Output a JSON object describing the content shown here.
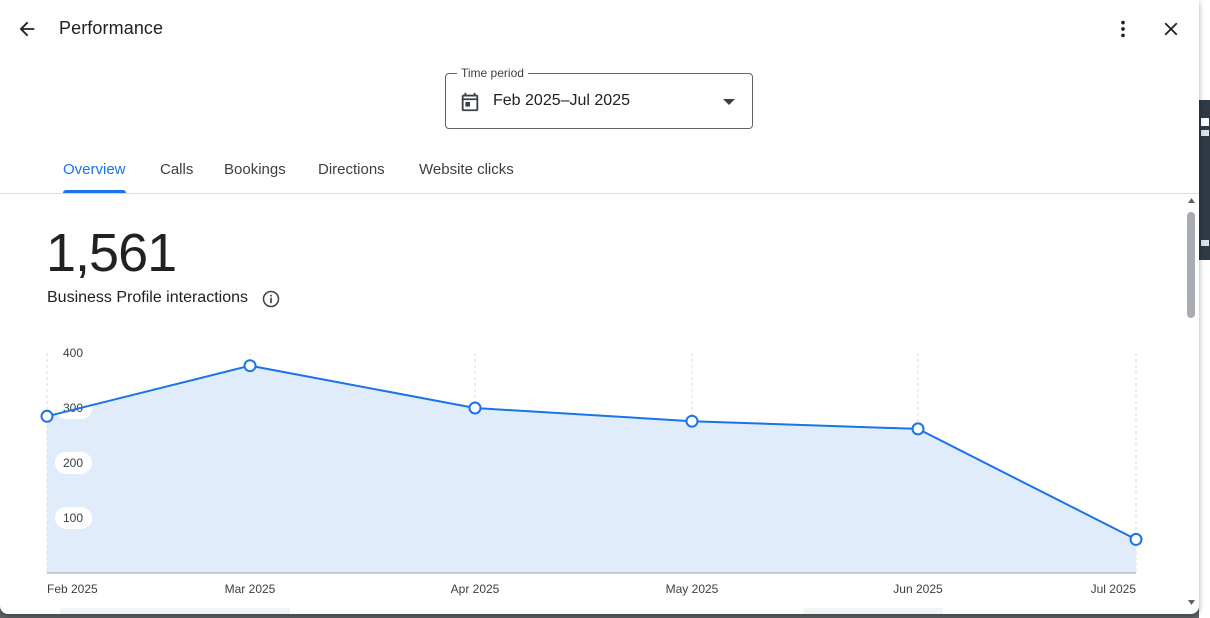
{
  "header": {
    "title": "Performance"
  },
  "time_period": {
    "label": "Time period",
    "value": "Feb 2025–Jul 2025"
  },
  "tabs": [
    {
      "label": "Overview",
      "active": true
    },
    {
      "label": "Calls",
      "active": false
    },
    {
      "label": "Bookings",
      "active": false
    },
    {
      "label": "Directions",
      "active": false
    },
    {
      "label": "Website clicks",
      "active": false
    }
  ],
  "summary": {
    "total": "1,561",
    "label": "Business Profile interactions"
  },
  "chart_data": {
    "type": "area",
    "x": [
      "Feb 2025",
      "Mar 2025",
      "Apr 2025",
      "May 2025",
      "Jun 2025",
      "Jul 2025"
    ],
    "series": [
      {
        "values": [
          285,
          377,
          300,
          276,
          262,
          61
        ]
      }
    ],
    "yticks": [
      100,
      200,
      300,
      400
    ],
    "ylim": [
      0,
      400
    ],
    "grid": "vertical dashed",
    "colors": {
      "line": "#1a73e8",
      "fill": "#e1ecfb",
      "point_fill": "#ffffff"
    }
  },
  "colors": {
    "accent": "#1a73e8",
    "text": "#202124",
    "muted": "#5f6368"
  }
}
